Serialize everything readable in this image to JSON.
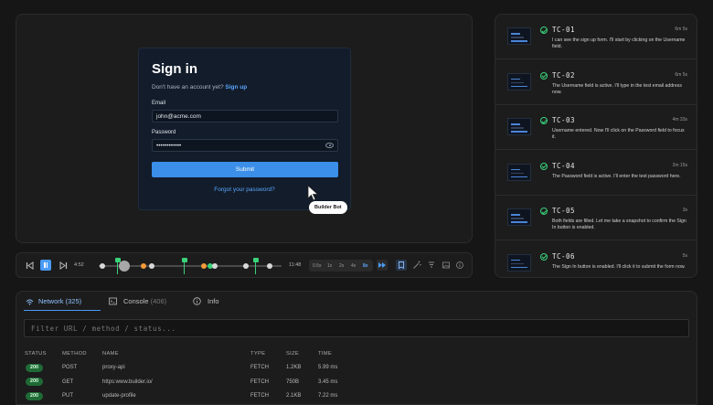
{
  "preview": {
    "signin": {
      "title": "Sign in",
      "signup_prompt": "Don't have an account yet?",
      "signup_link": "Sign up",
      "email_label": "Email",
      "email_value": "john@acme.com",
      "password_label": "Password",
      "password_value": "••••••••••••",
      "submit_label": "Submit",
      "forgot_label": "Forgot your password?"
    },
    "bot_label": "Builder Bot"
  },
  "playback": {
    "current_time": "4:52",
    "total_time": "11:48",
    "progress": 0.14,
    "speeds": [
      "0.5x",
      "1x",
      "2x",
      "4x",
      "8x"
    ],
    "active_speed": "8x"
  },
  "test_cases": [
    {
      "id": "TC-01",
      "time": "6m 5s",
      "desc": "I can see the sign up form. I'll start by clicking on the Username field."
    },
    {
      "id": "TC-02",
      "time": "6m 5s",
      "desc": "The Username field is active. I'll type in the test email address now."
    },
    {
      "id": "TC-03",
      "time": "4m 33s",
      "desc": "Username entered. Now I'll click on the Password field to focus it."
    },
    {
      "id": "TC-04",
      "time": "2m 15s",
      "desc": "The Password field is active. I'll enter the test password here."
    },
    {
      "id": "TC-05",
      "time": "3s",
      "desc": "Both fields are filled. Let me take a snapshot to confirm the Sign In button is enabled."
    },
    {
      "id": "TC-06",
      "time": "5s",
      "desc": "The Sign In button is enabled. I'll click it to submit the form now."
    }
  ],
  "network": {
    "tabs": [
      {
        "label": "Network",
        "count": "(325)"
      },
      {
        "label": "Console",
        "count": "(406)"
      },
      {
        "label": "Info",
        "count": ""
      }
    ],
    "filter_placeholder": "Filter URL / method / status...",
    "columns": [
      "STATUS",
      "METHOD",
      "NAME",
      "TYPE",
      "SIZE",
      "TIME"
    ],
    "rows": [
      {
        "status": "200",
        "method": "POST",
        "name": "proxy-api",
        "type": "FETCH",
        "size": "1.2KB",
        "time": "5.99 ms"
      },
      {
        "status": "200",
        "method": "GET",
        "name": "https:www.builder.io/",
        "type": "FETCH",
        "size": "750B",
        "time": "3.45 ms"
      },
      {
        "status": "200",
        "method": "PUT",
        "name": "update-profile",
        "type": "FETCH",
        "size": "2.1KB",
        "time": "7.22 ms"
      }
    ]
  },
  "colors": {
    "accent": "#4a9bf5",
    "success": "#3ad17a",
    "status_pill": "#1f6a36"
  }
}
